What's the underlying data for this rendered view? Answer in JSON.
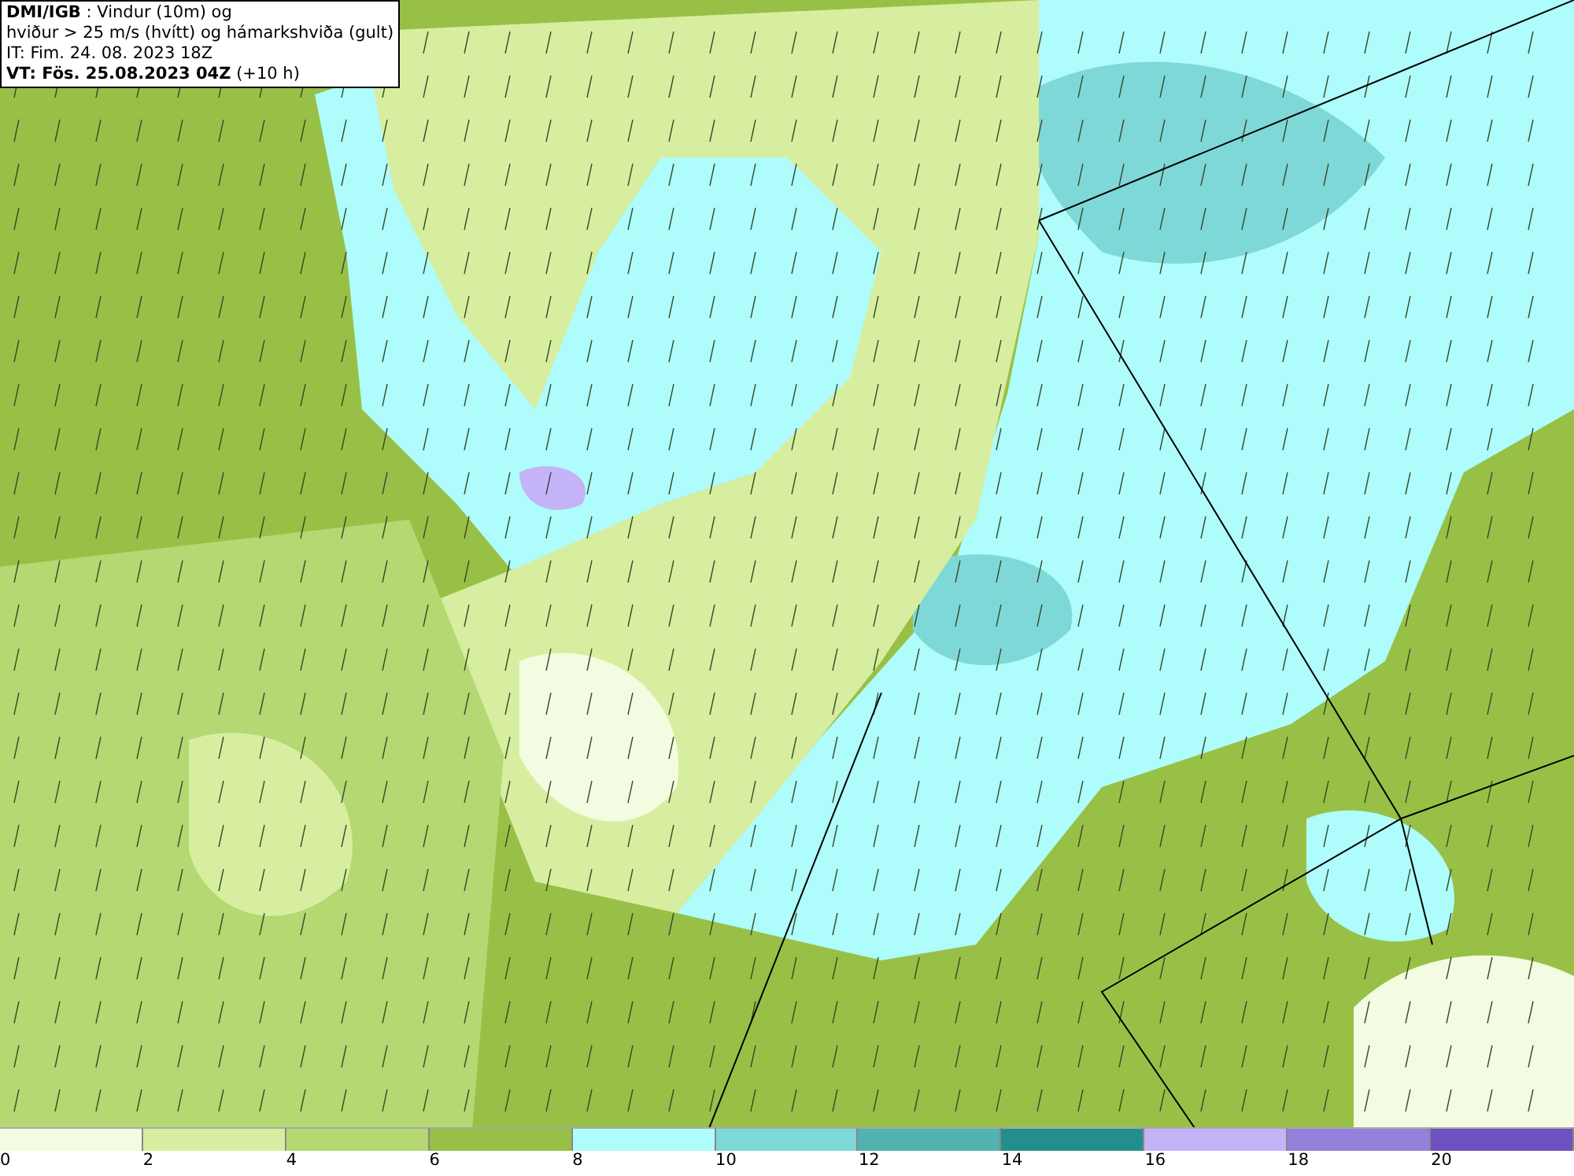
{
  "header": {
    "lines": [
      "**DMI/IGB** : Vindur (10m) og",
      "hviður > 25 m/s (hvítt) og hámarkshviða (gult)",
      "IT: Fim. 24. 08. 2023 18Z",
      "**VT: Fös. 25.08.2023 04Z** (+10 h)"
    ]
  },
  "legend": {
    "bins": [
      {
        "color": "#f3fbe0",
        "tick": "0"
      },
      {
        "color": "#d7eea0",
        "tick": "2"
      },
      {
        "color": "#b5d872",
        "tick": "4"
      },
      {
        "color": "#98c046",
        "tick": "6"
      },
      {
        "color": "#aefcfb",
        "tick": "8"
      },
      {
        "color": "#7fd8d8",
        "tick": "10"
      },
      {
        "color": "#52b2b0",
        "tick": "12"
      },
      {
        "color": "#228f8e",
        "tick": "14"
      },
      {
        "color": "#c5b3f8",
        "tick": "16"
      },
      {
        "color": "#9580dc",
        "tick": "18"
      },
      {
        "color": "#6e50c0",
        "tick": "20"
      }
    ]
  }
}
